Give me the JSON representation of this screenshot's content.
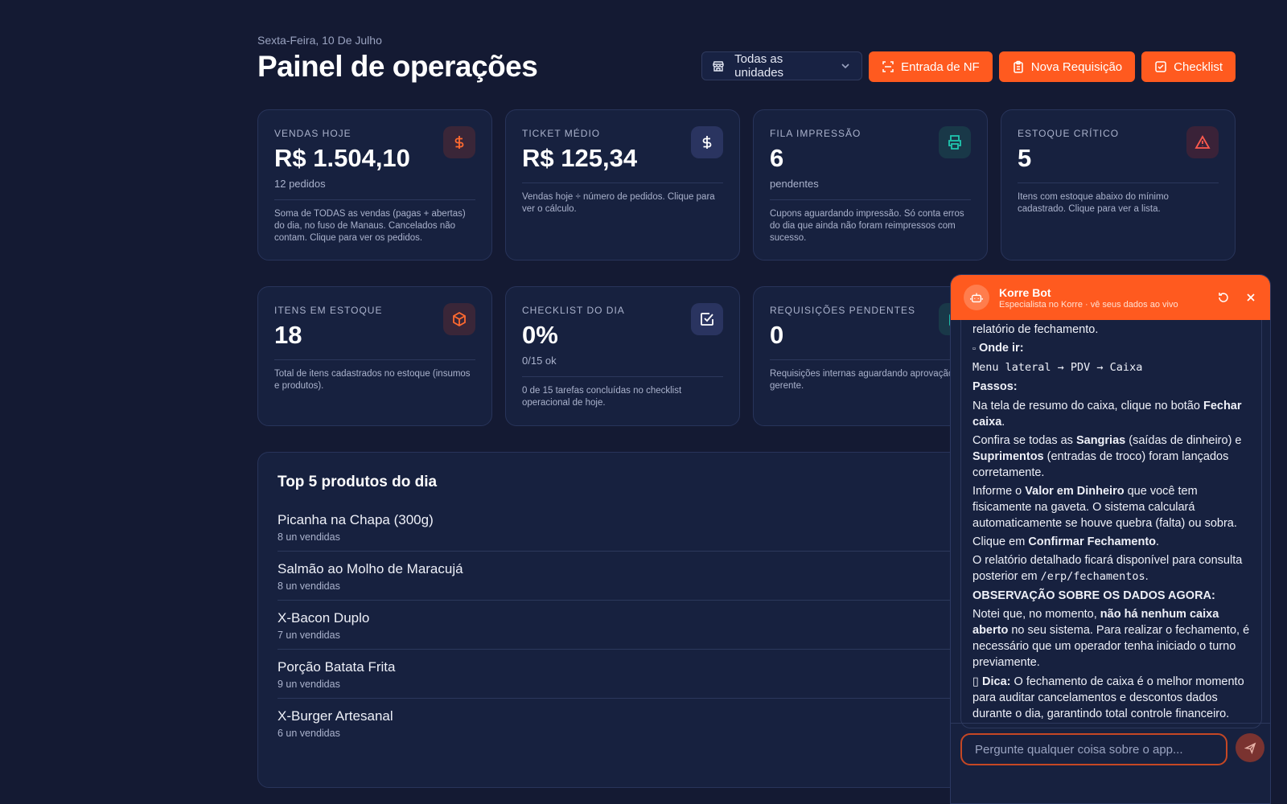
{
  "header": {
    "date": "Sexta-Feira, 10 De Julho",
    "title": "Painel de operações",
    "unit_select": "Todas as unidades",
    "btn_nf": "Entrada de NF",
    "btn_req": "Nova Requisição",
    "btn_checklist": "Checklist"
  },
  "cards": {
    "vendas": {
      "label": "VENDAS HOJE",
      "value": "R$ 1.504,10",
      "sub": "12 pedidos",
      "desc": "Soma de TODAS as vendas (pagas + abertas) do dia, no fuso de Manaus. Cancelados não contam. Clique para ver os pedidos.",
      "icon": "dollar-icon"
    },
    "ticket": {
      "label": "TICKET MÉDIO",
      "value": "R$ 125,34",
      "desc": "Vendas hoje ÷ número de pedidos. Clique para ver o cálculo.",
      "icon": "dollar-icon"
    },
    "fila": {
      "label": "FILA IMPRESSÃO",
      "value": "6",
      "sub": "pendentes",
      "desc": "Cupons aguardando impressão. Só conta erros do dia que ainda não foram reimpressos com sucesso.",
      "icon": "printer-icon"
    },
    "estoque_critico": {
      "label": "ESTOQUE CRÍTICO",
      "value": "5",
      "desc": "Itens com estoque abaixo do mínimo cadastrado. Clique para ver a lista.",
      "icon": "warning-icon"
    },
    "itens": {
      "label": "ITENS EM ESTOQUE",
      "value": "18",
      "desc": "Total de itens cadastrados no estoque (insumos e produtos).",
      "icon": "box-icon"
    },
    "checklist": {
      "label": "CHECKLIST DO DIA",
      "value": "0%",
      "sub": "0/15 ok",
      "desc": "0 de 15 tarefas concluídas no checklist operacional de hoje.",
      "icon": "checkbox-icon"
    },
    "requisicoes": {
      "label": "REQUISIÇÕES PENDENTES",
      "value": "0",
      "desc": "Requisições internas aguardando aprovação do gerente.",
      "icon": "clipboard-icon"
    }
  },
  "top5": {
    "title": "Top 5 produtos do dia",
    "products": [
      {
        "name": "Picanha na Chapa (300g)",
        "qty": "8 un vendidas"
      },
      {
        "name": "Salmão ao Molho de Maracujá",
        "qty": "8 un vendidas"
      },
      {
        "name": "X-Bacon Duplo",
        "qty": "7 un vendidas"
      },
      {
        "name": "Porção Batata Frita",
        "qty": "9 un vendidas"
      },
      {
        "name": "X-Burger Artesanal",
        "qty": "6 un vendidas"
      }
    ]
  },
  "chat": {
    "name": "Korre Bot",
    "status": "Especialista no Korre · vê seus dados ao vivo",
    "partial_line": "relatório de fechamento.",
    "where_label": "Onde ir:",
    "where_path": "Menu lateral → PDV → Caixa",
    "steps_label": "Passos:",
    "step1_a": "Na tela de resumo do caixa, clique no botão ",
    "step1_b": "Fechar caixa",
    "step1_c": ".",
    "step2_a": "Confira se todas as ",
    "step2_b": "Sangrias",
    "step2_c": " (saídas de dinheiro) e ",
    "step2_d": "Suprimentos",
    "step2_e": " (entradas de troco) foram lançados corretamente.",
    "step3_a": "Informe o ",
    "step3_b": "Valor em Dinheiro",
    "step3_c": " que você tem fisicamente na gaveta. O sistema calculará automaticamente se houve quebra (falta) ou sobra.",
    "step4_a": "Clique em ",
    "step4_b": "Confirmar Fechamento",
    "step4_c": ".",
    "report_a": "O relatório detalhado ficará disponível para consulta posterior em ",
    "report_b": "/erp/fechamentos",
    "report_c": ".",
    "obs_label": "OBSERVAÇÃO SOBRE OS DADOS AGORA:",
    "obs_a": "Notei que, no momento, ",
    "obs_b": "não há nenhum caixa aberto",
    "obs_c": " no seu sistema. Para realizar o fechamento, é necessário que um operador tenha iniciado o turno previamente.",
    "tip_label": "Dica:",
    "tip_text": " O fechamento de caixa é o melhor momento para auditar cancelamentos e descontos dados durante o dia, garantindo total controle financeiro.",
    "input_placeholder": "Pergunte qualquer coisa sobre o app..."
  },
  "colors": {
    "accent": "#ff5a1f",
    "bg": "#141a33",
    "card": "#17213f"
  }
}
